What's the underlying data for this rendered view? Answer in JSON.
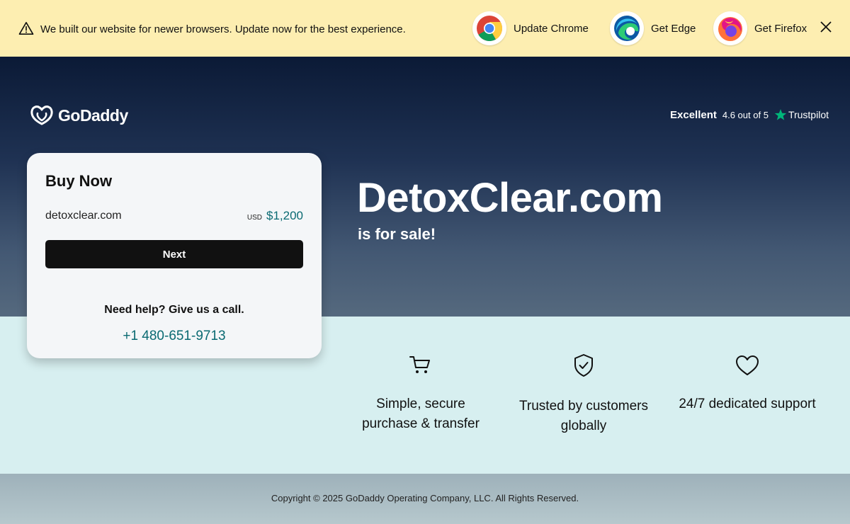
{
  "banner": {
    "message": "We built our website for newer browsers. Update now for the best experience.",
    "chrome_label": "Update Chrome",
    "edge_label": "Get Edge",
    "firefox_label": "Get Firefox"
  },
  "brand": {
    "name": "GoDaddy"
  },
  "trustpilot": {
    "rating_word": "Excellent",
    "score_text": "4.6 out of 5",
    "provider": "Trustpilot"
  },
  "hero": {
    "domain": "DetoxClear.com",
    "subtitle": "is for sale!"
  },
  "buy_card": {
    "heading": "Buy Now",
    "domain": "detoxclear.com",
    "currency": "USD",
    "price": "$1,200",
    "next_label": "Next",
    "help_text": "Need help? Give us a call.",
    "phone": "+1 480-651-9713"
  },
  "features": [
    {
      "icon": "cart-icon",
      "line1": "Simple, secure",
      "line2": "purchase & transfer"
    },
    {
      "icon": "shield-check-icon",
      "line1": "Trusted by customers",
      "line2": "globally"
    },
    {
      "icon": "heart-icon",
      "line1": "24/7 dedicated support",
      "line2": ""
    }
  ],
  "footer": {
    "copyright": "Copyright © 2025 GoDaddy Operating Company, LLC. All Rights Reserved."
  },
  "colors": {
    "banner_bg": "#fdeeb1",
    "accent_teal": "#0a6a72",
    "feature_bg": "#d7eff0",
    "trustpilot_green": "#00b67a"
  }
}
